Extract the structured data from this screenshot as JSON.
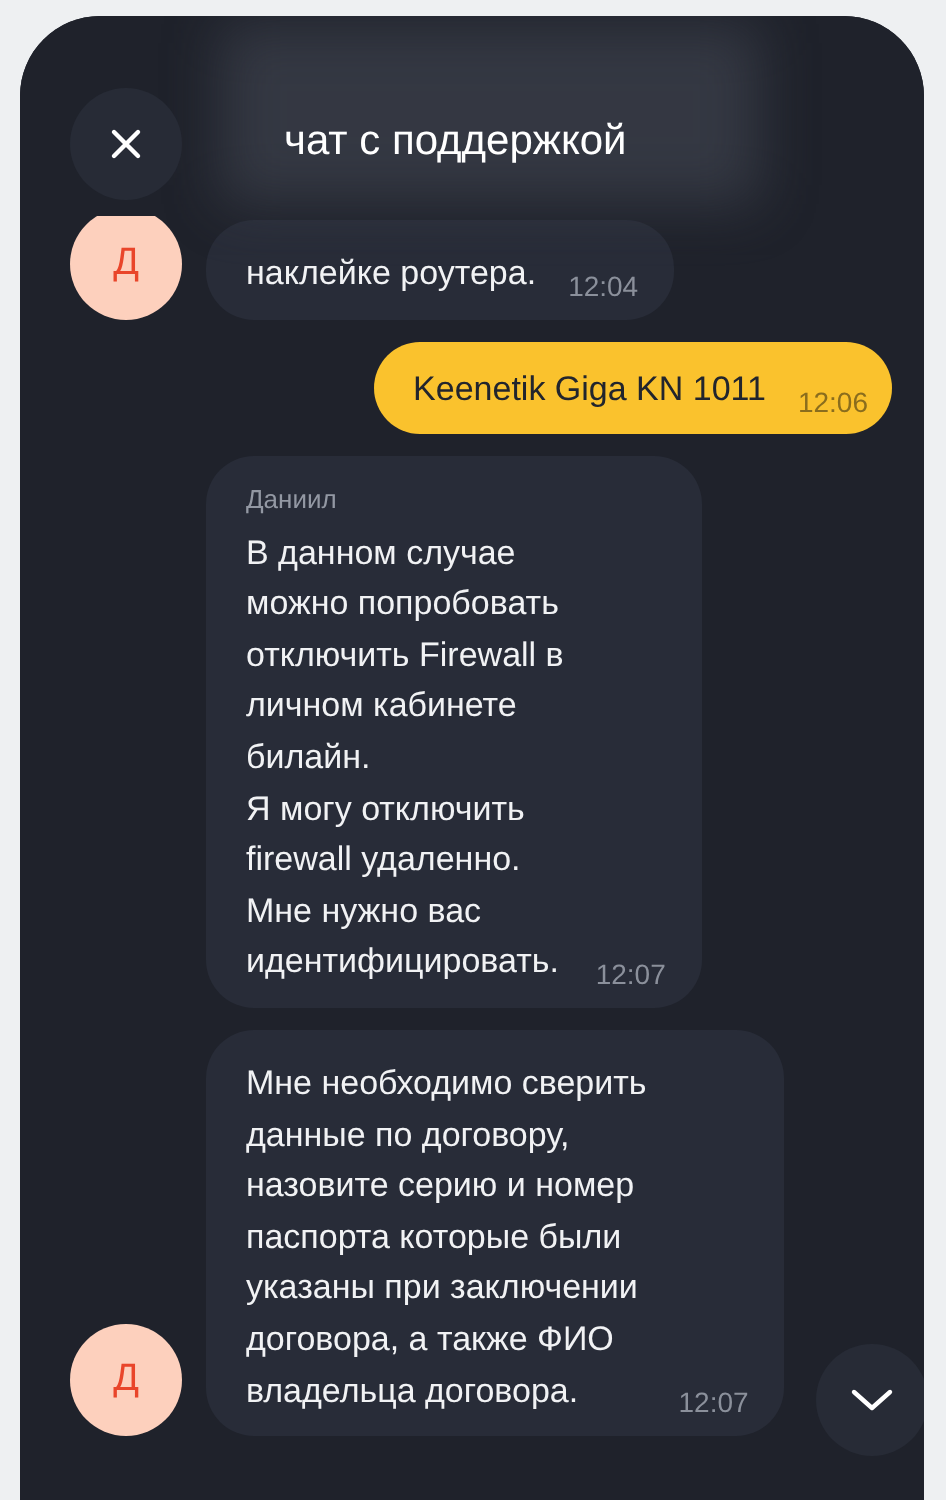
{
  "header": {
    "title": "чат с поддержкой"
  },
  "messages": [
    {
      "kind": "incoming",
      "avatar": "Д",
      "text": "наклейке роутера.",
      "time": "12:04"
    },
    {
      "kind": "outgoing",
      "text": "Keenetik Giga KN 1011",
      "time": "12:06"
    },
    {
      "kind": "incoming",
      "sender": "Даниил",
      "text": "В данном случае\nможно попробовать\nотключить Firewall в\nличном кабинете\nбилайн.\nЯ могу отключить\nfirewall удаленно.\nМне нужно вас\nидентифицировать.",
      "time": "12:07"
    },
    {
      "kind": "incoming",
      "avatar": "Д",
      "text": "Мне необходимо сверить\nданные по договору,\nназовите серию и номер\nпаспорта которые были\nуказаны при заключении\nдоговора, а также ФИО\nвладельца договора.",
      "time": "12:07"
    }
  ]
}
